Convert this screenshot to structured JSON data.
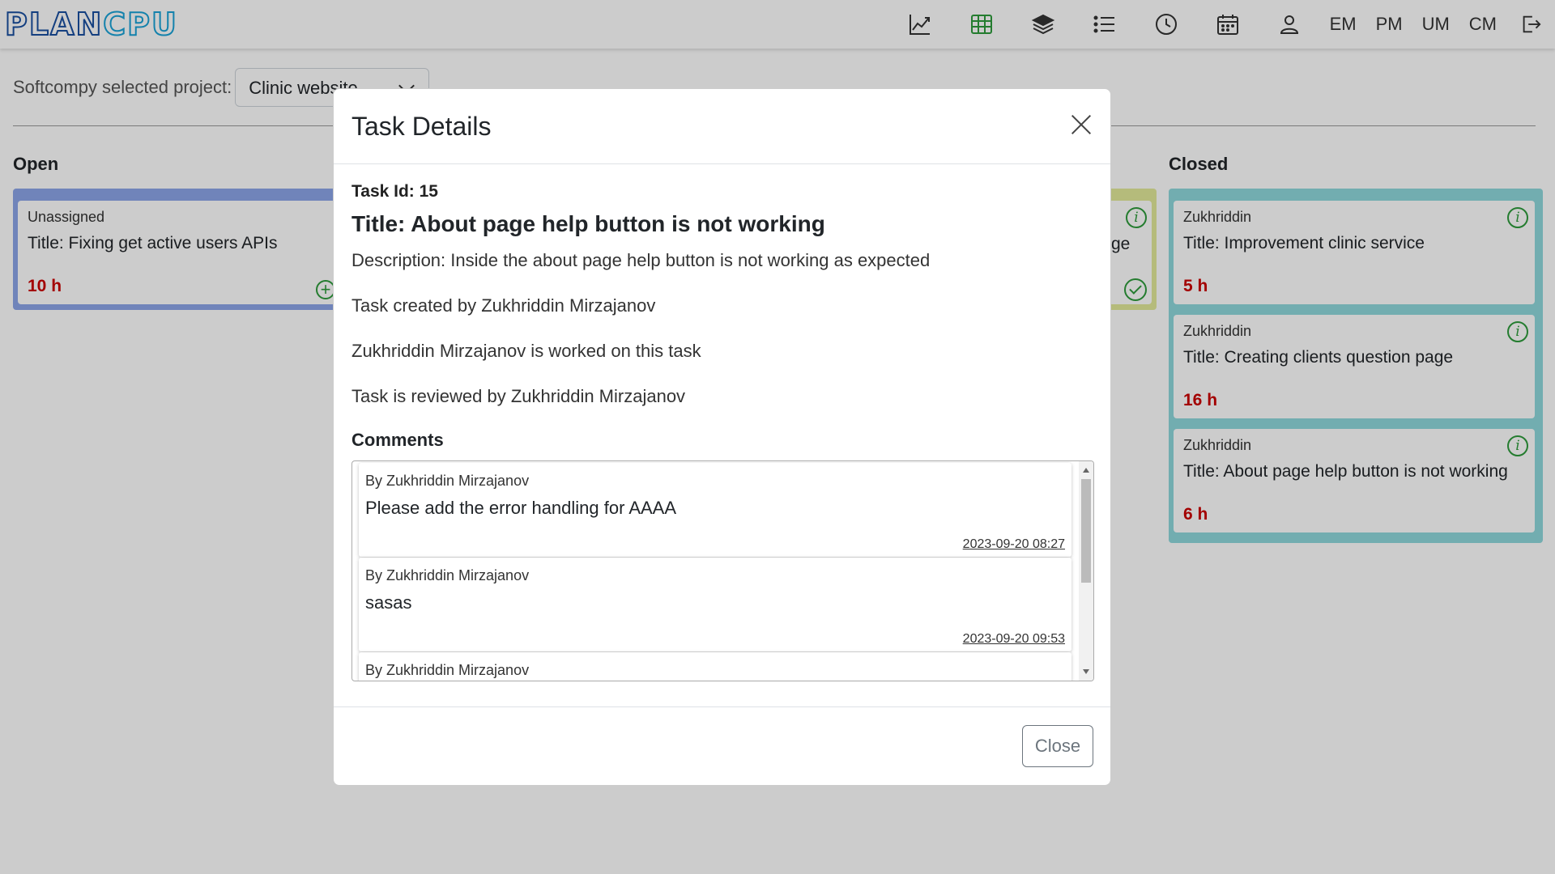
{
  "navbar": {
    "logo_text": "PLANCPU",
    "icons": [
      "chart-line-icon",
      "table-icon",
      "layers-icon",
      "list-icon",
      "clock-icon",
      "calendar-icon",
      "user-icon"
    ],
    "text_items": [
      "EM",
      "PM",
      "UM",
      "CM"
    ],
    "logout_icon": "logout-icon"
  },
  "project": {
    "label": "Softcompy selected project:",
    "selected": "Clinic website"
  },
  "board": {
    "open": {
      "title": "Open",
      "cards": [
        {
          "assignee": "Unassigned",
          "title": "Title: Fixing get active users APIs",
          "hours": "10 h"
        }
      ]
    },
    "review_partial_text": "ge",
    "closed": {
      "title": "Closed",
      "cards": [
        {
          "assignee": "Zukhriddin",
          "title": "Title: Improvement clinic service",
          "hours": "5 h"
        },
        {
          "assignee": "Zukhriddin",
          "title": "Title: Creating clients question page",
          "hours": "16 h"
        },
        {
          "assignee": "Zukhriddin",
          "title": "Title: About page help button is not working",
          "hours": "6 h"
        }
      ]
    }
  },
  "modal": {
    "title": "Task Details",
    "task_id": "Task Id: 15",
    "task_title": "Title: About page help button is not working",
    "description": "Description: Inside the about page help button is not working as expected",
    "created_by": "Task created by Zukhriddin Mirzajanov",
    "worked_by": "Zukhriddin Mirzajanov is worked on this task",
    "reviewed_by": "Task is reviewed by Zukhriddin Mirzajanov",
    "comments_label": "Comments",
    "comments": [
      {
        "by": "By Zukhriddin Mirzajanov",
        "text": "Please add the error handling for AAAA",
        "date": "2023-09-20 08:27"
      },
      {
        "by": "By Zukhriddin Mirzajanov",
        "text": "sasas",
        "date": "2023-09-20 09:53"
      },
      {
        "by": "By Zukhriddin Mirzajanov",
        "text": "",
        "date": ""
      }
    ],
    "close_button": "Close"
  },
  "colors": {
    "accent_green": "#2e9c3b",
    "hours_red": "#cc0000",
    "logo_dark_blue": "#1a4fa0",
    "logo_light_blue": "#1aa3d8",
    "open_column": "#5b7fe0",
    "review_column": "#e3ea9a",
    "closed_column": "#8fd9dd"
  }
}
